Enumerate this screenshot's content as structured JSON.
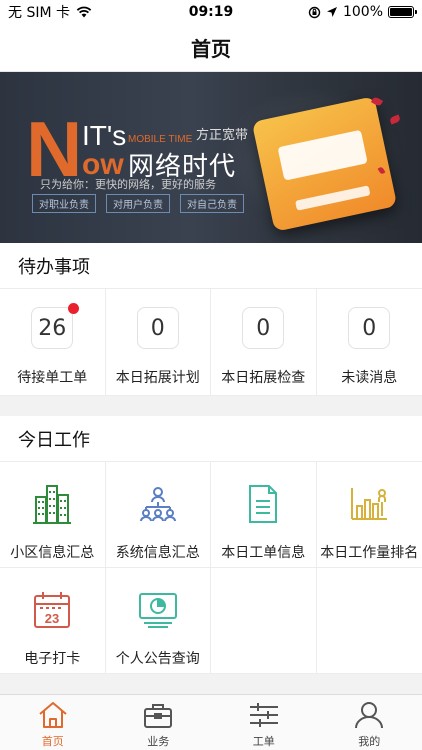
{
  "status_bar": {
    "carrier": "无 SIM 卡",
    "time": "09:19",
    "battery": "100%",
    "battery_level": 1.0
  },
  "nav": {
    "title": "首页"
  },
  "banner": {
    "letter_n": "N",
    "its": "IT's",
    "ow": "ow",
    "mobile_time": "MOBILE TIME",
    "brand": "方正宽带",
    "slogan": "网络时代",
    "subtitle": "只为给你：更快的网络，更好的服务",
    "tags": [
      "对职业负责",
      "对用户负责",
      "对自己负责"
    ]
  },
  "todo": {
    "title": "待办事项",
    "items": [
      {
        "count": "26",
        "label": "待接单工单",
        "has_badge": true
      },
      {
        "count": "0",
        "label": "本日拓展计划",
        "has_badge": false
      },
      {
        "count": "0",
        "label": "本日拓展检查",
        "has_badge": false
      },
      {
        "count": "0",
        "label": "未读消息",
        "has_badge": false
      }
    ]
  },
  "work": {
    "title": "今日工作",
    "items": [
      {
        "label": "小区信息汇总",
        "icon": "building-icon",
        "color": "#2e8b3a"
      },
      {
        "label": "系统信息汇总",
        "icon": "org-chart-icon",
        "color": "#5b7fc4"
      },
      {
        "label": "本日工单信息",
        "icon": "document-icon",
        "color": "#3fb8a0"
      },
      {
        "label": "本日工作量排名",
        "icon": "ranking-icon",
        "color": "#d6b23a"
      },
      {
        "label": "电子打卡",
        "icon": "calendar-icon",
        "color": "#d35a4a"
      },
      {
        "label": "个人公告查询",
        "icon": "monitor-chart-icon",
        "color": "#3fb8a0"
      }
    ]
  },
  "tabs": [
    {
      "label": "首页",
      "icon": "home-icon",
      "active": true
    },
    {
      "label": "业务",
      "icon": "briefcase-icon",
      "active": false
    },
    {
      "label": "工单",
      "icon": "sliders-icon",
      "active": false
    },
    {
      "label": "我的",
      "icon": "user-icon",
      "active": false
    }
  ],
  "colors": {
    "accent": "#e06a2c",
    "badge": "#e8212c"
  }
}
